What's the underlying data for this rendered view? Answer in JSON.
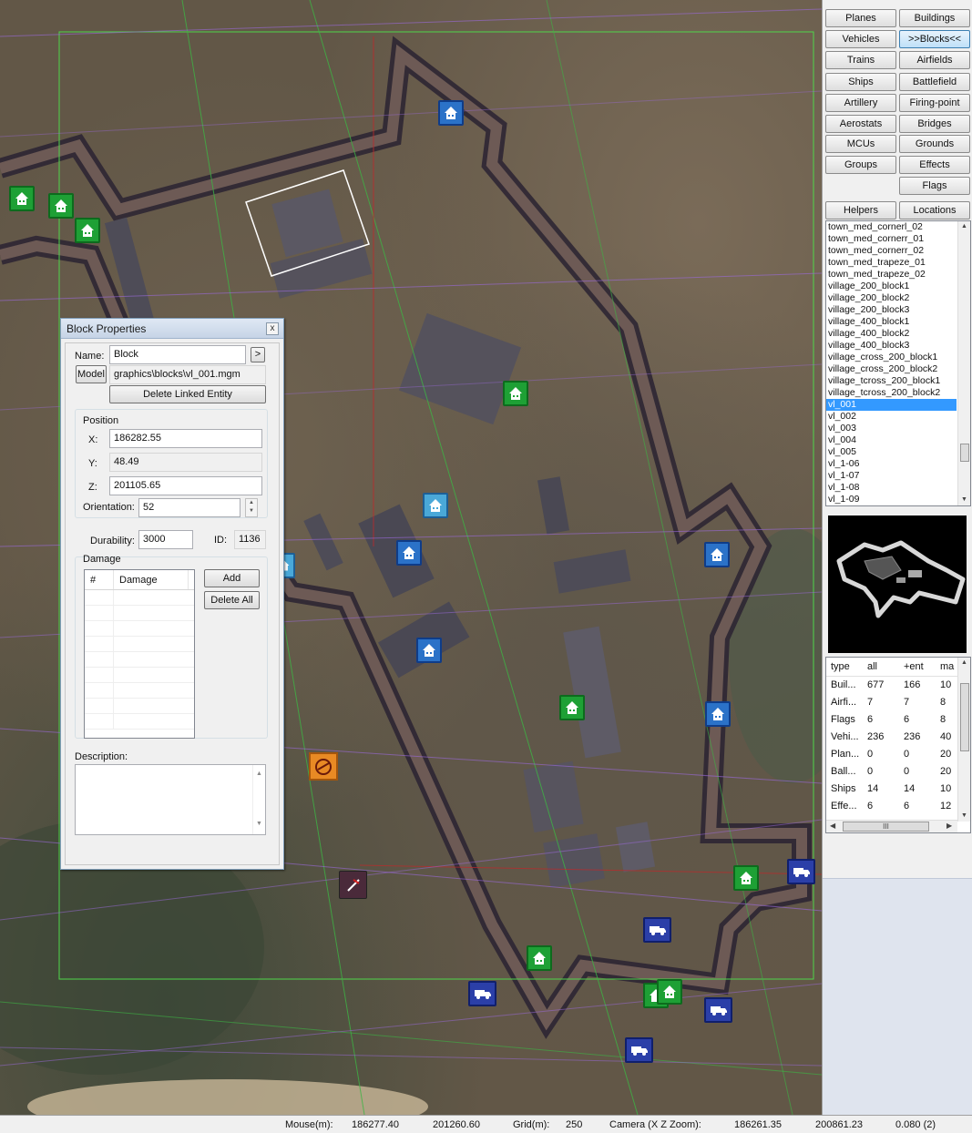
{
  "dialog": {
    "title": "Block Properties",
    "close": "x",
    "name_label": "Name:",
    "name_value": "Block",
    "name_arrow": ">",
    "model_button": "Model",
    "model_value": "graphics\\blocks\\vl_001.mgm",
    "delete_linked": "Delete Linked Entity",
    "position_label": "Position",
    "x_label": "X:",
    "x_value": "186282.55",
    "y_label": "Y:",
    "y_value": "48.49",
    "z_label": "Z:",
    "z_value": "201105.65",
    "orientation_label": "Orientation:",
    "orientation_value": "52",
    "durability_label": "Durability:",
    "durability_value": "3000",
    "id_label": "ID:",
    "id_value": "1136",
    "damage_label": "Damage",
    "damage_col_num": "#",
    "damage_col_damage": "Damage",
    "add_button": "Add",
    "delete_all_button": "Delete All",
    "description_label": "Description:"
  },
  "panel": {
    "buttons": [
      {
        "label": "Planes"
      },
      {
        "label": "Buildings"
      },
      {
        "label": "Vehicles"
      },
      {
        "label": ">>Blocks<<"
      },
      {
        "label": "Trains"
      },
      {
        "label": "Airfields"
      },
      {
        "label": "Ships"
      },
      {
        "label": "Battlefield"
      },
      {
        "label": "Artillery"
      },
      {
        "label": "Firing-point"
      },
      {
        "label": "Aerostats"
      },
      {
        "label": "Bridges"
      },
      {
        "label": "MCUs"
      },
      {
        "label": "Grounds"
      },
      {
        "label": "Groups"
      },
      {
        "label": "Effects"
      },
      {
        "label": ""
      },
      {
        "label": "Flags"
      }
    ],
    "helpers": "Helpers",
    "locations": "Locations",
    "block_list": [
      "town_med_cornerl_02",
      "town_med_cornerr_01",
      "town_med_cornerr_02",
      "town_med_trapeze_01",
      "town_med_trapeze_02",
      "village_200_block1",
      "village_200_block2",
      "village_200_block3",
      "village_400_block1",
      "village_400_block2",
      "village_400_block3",
      "village_cross_200_block1",
      "village_cross_200_block2",
      "village_tcross_200_block1",
      "village_tcross_200_block2",
      "vl_001",
      "vl_002",
      "vl_003",
      "vl_004",
      "vl_005",
      "vl_1-06",
      "vl_1-07",
      "vl_1-08",
      "vl_1-09"
    ],
    "selected_block": "vl_001",
    "stats": {
      "headers": [
        "type",
        "all",
        "+ent",
        "ma"
      ],
      "rows": [
        [
          "Buil...",
          "677",
          "166",
          "10"
        ],
        [
          "Airfi...",
          "7",
          "7",
          "8"
        ],
        [
          "Flags",
          "6",
          "6",
          "8"
        ],
        [
          "Vehi...",
          "236",
          "236",
          "40"
        ],
        [
          "Plan...",
          "0",
          "0",
          "20"
        ],
        [
          "Ball...",
          "0",
          "0",
          "20"
        ],
        [
          "Ships",
          "14",
          "14",
          "10"
        ],
        [
          "Effe...",
          "6",
          "6",
          "12"
        ]
      ]
    }
  },
  "status": {
    "mouse_label": "Mouse(m):",
    "mouse_x": "186277.40",
    "mouse_z": "201260.60",
    "grid_label": "Grid(m):",
    "grid_value": "250",
    "camera_label": "Camera (X  Z  Zoom):",
    "camera_x": "186261.35",
    "camera_z": "200861.23",
    "camera_zoom": "0.080 (2)"
  },
  "icons": {
    "house": "house-marker-icon",
    "truck": "vehicle-marker-icon",
    "artillery": "artillery-marker-icon",
    "plane": "plane-marker-icon"
  },
  "colors": {
    "selection": "#3399ff",
    "house_marker": "#1ea035",
    "vehicle_marker": "#2b3fa8",
    "active_tab": "#bfe0f8"
  }
}
